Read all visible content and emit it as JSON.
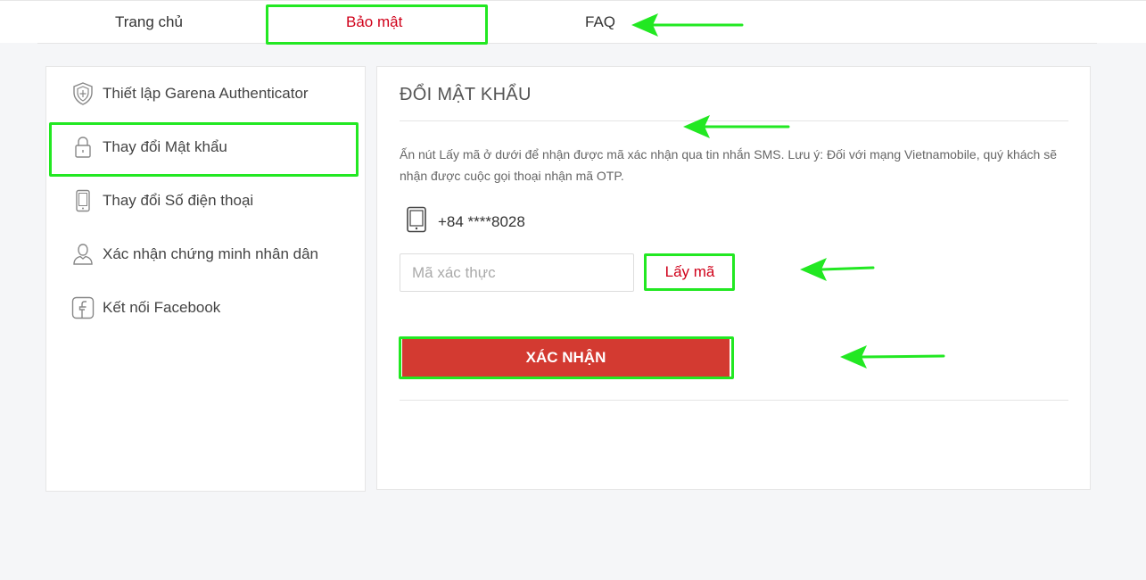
{
  "nav": {
    "tabs": [
      {
        "label": "Trang chủ"
      },
      {
        "label": "Bảo mật"
      },
      {
        "label": "FAQ"
      }
    ]
  },
  "sidebar": {
    "items": [
      {
        "label": "Thiết lập Garena Authenticator",
        "icon": "shield-icon"
      },
      {
        "label": "Thay đổi Mật khẩu",
        "icon": "lock-icon"
      },
      {
        "label": "Thay đổi Số điện thoại",
        "icon": "phone-icon"
      },
      {
        "label": "Xác nhận chứng minh nhân dân",
        "icon": "user-icon"
      },
      {
        "label": "Kết nối Facebook",
        "icon": "facebook-icon"
      }
    ]
  },
  "main": {
    "title": "ĐỔI MẬT KHẨU",
    "description": "Ấn nút Lấy mã ở dưới để nhận được mã xác nhận qua tin nhắn SMS. Lưu ý: Đối với mạng Vietnamobile, quý khách sẽ nhận được cuộc gọi thoại nhận mã OTP.",
    "phone": "+84 ****8028",
    "code_placeholder": "Mã xác thực",
    "code_value": "",
    "get_code_label": "Lấy mã",
    "confirm_label": "XÁC NHẬN"
  },
  "colors": {
    "accent": "#d0021b",
    "confirm_bg": "#d33a31",
    "highlight": "#22e822"
  }
}
